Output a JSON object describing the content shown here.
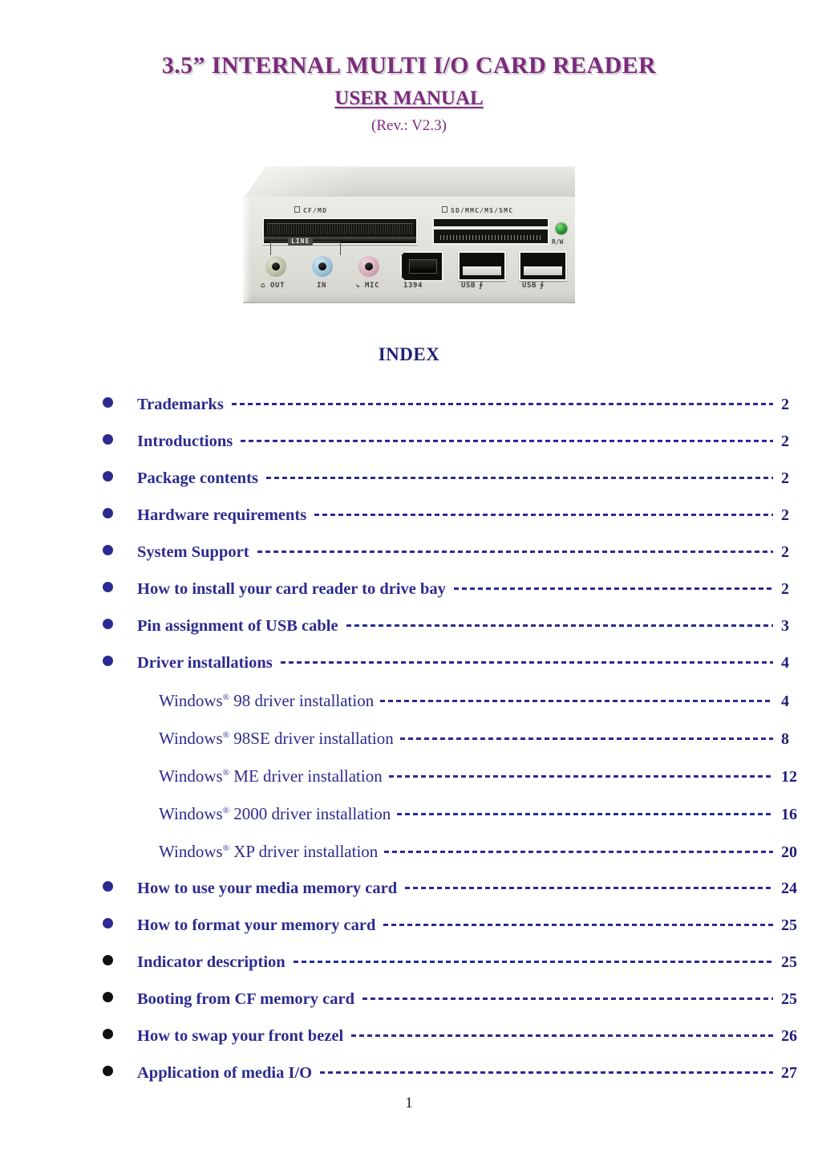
{
  "document": {
    "title": "3.5” INTERNAL MULTI I/O CARD READER",
    "subtitle": "USER MANUAL",
    "revision": "(Rev.: V2.3)",
    "page_number": "1",
    "colors": {
      "title_purple": "#7d2a7d",
      "index_navy": "#1f1f7a",
      "entry_blue": "#2b2b8f",
      "bullet_black": "#111111"
    }
  },
  "product_image": {
    "alt": "3.5 inch internal multi I/O card reader front bezel",
    "slot_labels": [
      {
        "name": "cf-md-slot-label",
        "text": "CF/MD"
      },
      {
        "name": "sd-mmc-ms-smc-slot-label",
        "text": "SD/MMC/MS/SMC"
      }
    ],
    "indicator_label": "R/W",
    "line_bracket_label": "LINE",
    "port_labels": [
      {
        "name": "headphone-out-label",
        "text": "⌂ OUT"
      },
      {
        "name": "line-in-label",
        "text": "IN"
      },
      {
        "name": "mic-label",
        "text": "↘ MIC"
      },
      {
        "name": "firewire-1394-label",
        "text": "1394"
      },
      {
        "name": "usb-port-1-label",
        "text": "USB"
      },
      {
        "name": "usb-port-2-label",
        "text": "USB"
      }
    ]
  },
  "index": {
    "heading": "INDEX",
    "entries": [
      {
        "label": "Trademarks",
        "page": "2",
        "bullet": "blue",
        "level": 0
      },
      {
        "label": "Introductions",
        "page": "2",
        "bullet": "blue",
        "level": 0
      },
      {
        "label": "Package contents",
        "page": "2",
        "bullet": "blue",
        "level": 0
      },
      {
        "label": "Hardware requirements",
        "page": "2",
        "bullet": "blue",
        "level": 0
      },
      {
        "label": "System Support",
        "page": "2",
        "bullet": "blue",
        "level": 0
      },
      {
        "label": "How to install your card reader to drive bay",
        "page": "2",
        "bullet": "blue",
        "level": 0
      },
      {
        "label": "Pin assignment of USB cable",
        "page": "3",
        "bullet": "blue",
        "level": 0
      },
      {
        "label": "Driver installations",
        "page": "4",
        "bullet": "blue",
        "level": 0
      },
      {
        "label_pre": "Windows",
        "label_sup": "®",
        "label_post": " 98 driver installation",
        "page": "4",
        "level": 1
      },
      {
        "label_pre": "Windows",
        "label_sup": "®",
        "label_post": " 98SE driver installation",
        "page": "8",
        "level": 1
      },
      {
        "label_pre": "Windows",
        "label_sup": "®",
        "label_post": " ME driver installation",
        "page": "12",
        "level": 1
      },
      {
        "label_pre": "Windows",
        "label_sup": "®",
        "label_post": " 2000 driver installation",
        "page": "16",
        "level": 1
      },
      {
        "label_pre": "Windows",
        "label_sup": "®",
        "label_post": " XP driver installation",
        "page": "20",
        "level": 1
      },
      {
        "label": "How to use your media memory card",
        "page": "24",
        "bullet": "blue",
        "level": 0
      },
      {
        "label": "How to format your memory card",
        "page": "25",
        "bullet": "blue",
        "level": 0
      },
      {
        "label": "Indicator description",
        "page": "25",
        "bullet": "black",
        "level": 0
      },
      {
        "label": "Booting from CF memory card",
        "page": "25",
        "bullet": "black",
        "level": 0
      },
      {
        "label": "How to swap your front bezel",
        "page": "26",
        "bullet": "black",
        "level": 0
      },
      {
        "label": "Application of media I/O",
        "page": "27",
        "bullet": "black",
        "level": 0
      }
    ]
  }
}
